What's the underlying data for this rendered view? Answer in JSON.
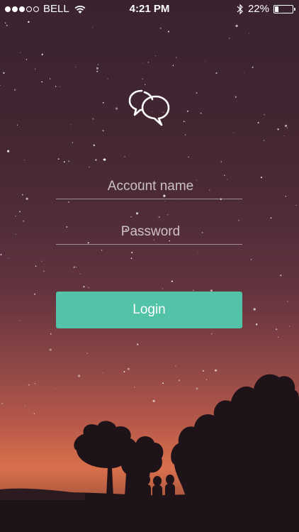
{
  "status_bar": {
    "carrier": "BELL",
    "time": "4:21 PM",
    "battery_percent": "22%",
    "battery_level": 0.22,
    "signal_bars_filled": 3,
    "signal_bars_total": 5,
    "icons": [
      "wifi-icon",
      "bluetooth-icon",
      "battery-icon"
    ]
  },
  "logo": {
    "icon": "chat-bubbles-icon"
  },
  "form": {
    "account_placeholder": "Account name",
    "account_value": "",
    "password_placeholder": "Password",
    "password_value": "",
    "login_label": "Login"
  },
  "colors": {
    "accent": "#52c2a8",
    "sky_top": "#3a2330",
    "horizon": "#d9704c"
  }
}
